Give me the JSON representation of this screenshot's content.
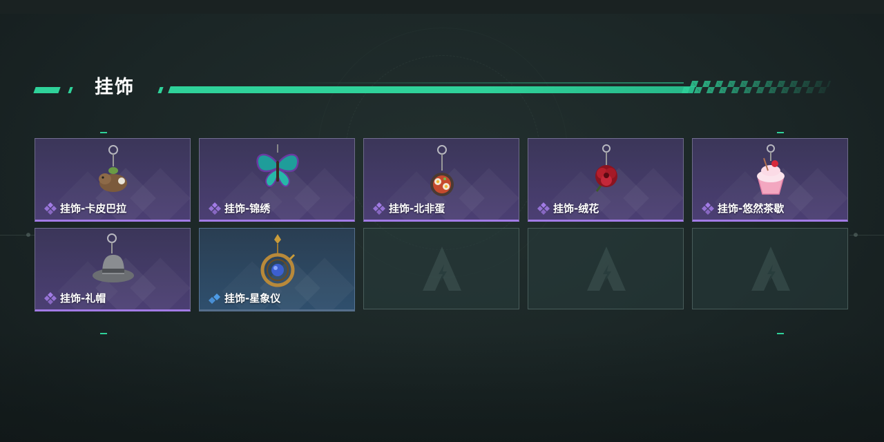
{
  "header": {
    "title": "挂饰"
  },
  "colors": {
    "accent": "#2fd29a",
    "epic": "#a27be6",
    "rare": "#4d9be6"
  },
  "items": [
    {
      "name": "挂饰-卡皮巴拉",
      "rarity": "epic",
      "icon": "capybara-charm-icon"
    },
    {
      "name": "挂饰-锦绣",
      "rarity": "epic",
      "icon": "butterfly-charm-icon"
    },
    {
      "name": "挂饰-北非蛋",
      "rarity": "epic",
      "icon": "shakshuka-charm-icon"
    },
    {
      "name": "挂饰-绒花",
      "rarity": "epic",
      "icon": "red-flower-charm-icon"
    },
    {
      "name": "挂饰-悠然茶歇",
      "rarity": "epic",
      "icon": "cupcake-charm-icon"
    },
    {
      "name": "挂饰-礼帽",
      "rarity": "epic",
      "icon": "hat-charm-icon"
    },
    {
      "name": "挂饰-星象仪",
      "rarity": "rare",
      "icon": "astrolabe-charm-icon"
    }
  ],
  "empty_slots": [
    {
      "icon": "game-logo-icon"
    },
    {
      "icon": "game-logo-icon"
    },
    {
      "icon": "game-logo-icon"
    }
  ]
}
